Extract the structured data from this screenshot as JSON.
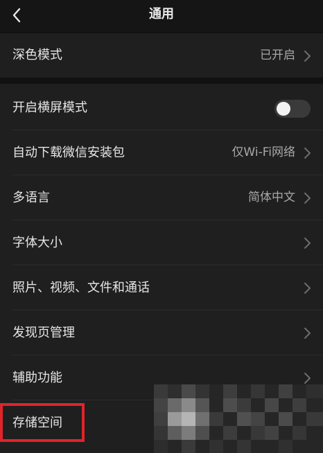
{
  "header": {
    "title": "通用"
  },
  "settings": {
    "dark_mode": {
      "label": "深色模式",
      "value": "已开启"
    },
    "items": [
      {
        "label": "开启横屏模式",
        "toggle": false
      },
      {
        "label": "自动下载微信安装包",
        "value": "仅Wi-Fi网络"
      },
      {
        "label": "多语言",
        "value": "简体中文"
      },
      {
        "label": "字体大小"
      },
      {
        "label": "照片、视频、文件和通话"
      },
      {
        "label": "发现页管理"
      },
      {
        "label": "辅助功能"
      },
      {
        "label": "存储空间"
      }
    ]
  },
  "colors": {
    "background": "#111111",
    "row_background": "#1f1f1f",
    "text": "#e6e6e6",
    "secondary_text": "#a8a8a8",
    "highlight": "#e0242c"
  },
  "icons": {
    "back": "chevron-left-icon",
    "disclosure": "chevron-right-icon"
  }
}
